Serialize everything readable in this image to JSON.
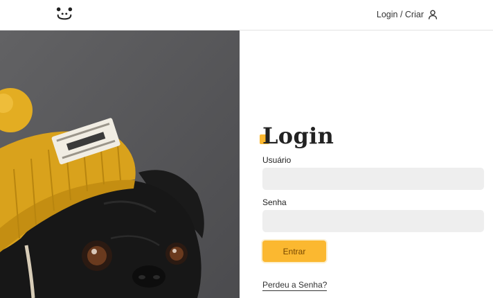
{
  "header": {
    "logo_icon": "dog-face-icon",
    "login_label": "Login / Criar",
    "user_icon": "user-icon"
  },
  "hero_image": {
    "subject": "pug-wearing-yellow-beanie"
  },
  "form": {
    "title": "Login",
    "username_label": "Usuário",
    "username_value": "",
    "password_label": "Senha",
    "password_value": "",
    "submit_label": "Entrar",
    "lost_password_label": "Perdeu a Senha?"
  },
  "colors": {
    "accent": "#fbb830",
    "input_bg": "#eeeeee",
    "button_text": "#764701"
  }
}
